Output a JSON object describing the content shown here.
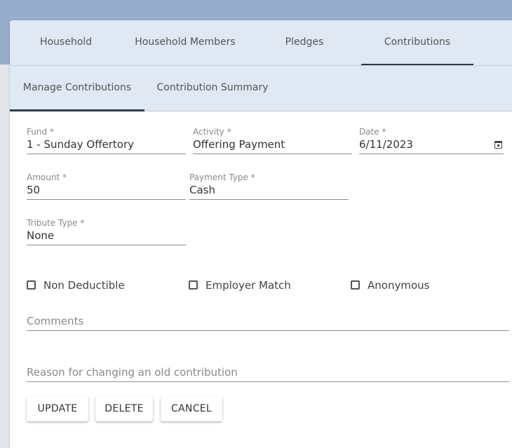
{
  "tabs": {
    "primary": [
      {
        "label": "Household"
      },
      {
        "label": "Household Members"
      },
      {
        "label": "Pledges"
      },
      {
        "label": "Contributions"
      }
    ],
    "primary_active": "Contributions",
    "secondary": [
      {
        "label": "Manage Contributions"
      },
      {
        "label": "Contribution Summary"
      }
    ],
    "secondary_active": "Manage Contributions"
  },
  "form": {
    "fund": {
      "label": "Fund *",
      "value": "1 - Sunday Offertory"
    },
    "activity": {
      "label": "Activity *",
      "value": "Offering Payment"
    },
    "date": {
      "label": "Date *",
      "value": "6/11/2023",
      "icon": "calendar-icon"
    },
    "amount": {
      "label": "Amount *",
      "value": "50"
    },
    "payment_type": {
      "label": "Payment Type *",
      "value": "Cash"
    },
    "tribute_type": {
      "label": "Tribute Type *",
      "value": "None"
    },
    "checkboxes": [
      {
        "label": "Non Deductible",
        "checked": false
      },
      {
        "label": "Employer Match",
        "checked": false
      },
      {
        "label": "Anonymous",
        "checked": false
      }
    ],
    "comments": {
      "placeholder": "Comments",
      "value": ""
    },
    "reason": {
      "placeholder": "Reason for changing an old contribution",
      "value": ""
    }
  },
  "buttons": {
    "update": "UPDATE",
    "delete": "DELETE",
    "cancel": "CANCEL"
  },
  "colors": {
    "header_band": "#97adcb",
    "tab_bar": "#dfe8f3",
    "active_indicator": "#2f3b4c"
  }
}
